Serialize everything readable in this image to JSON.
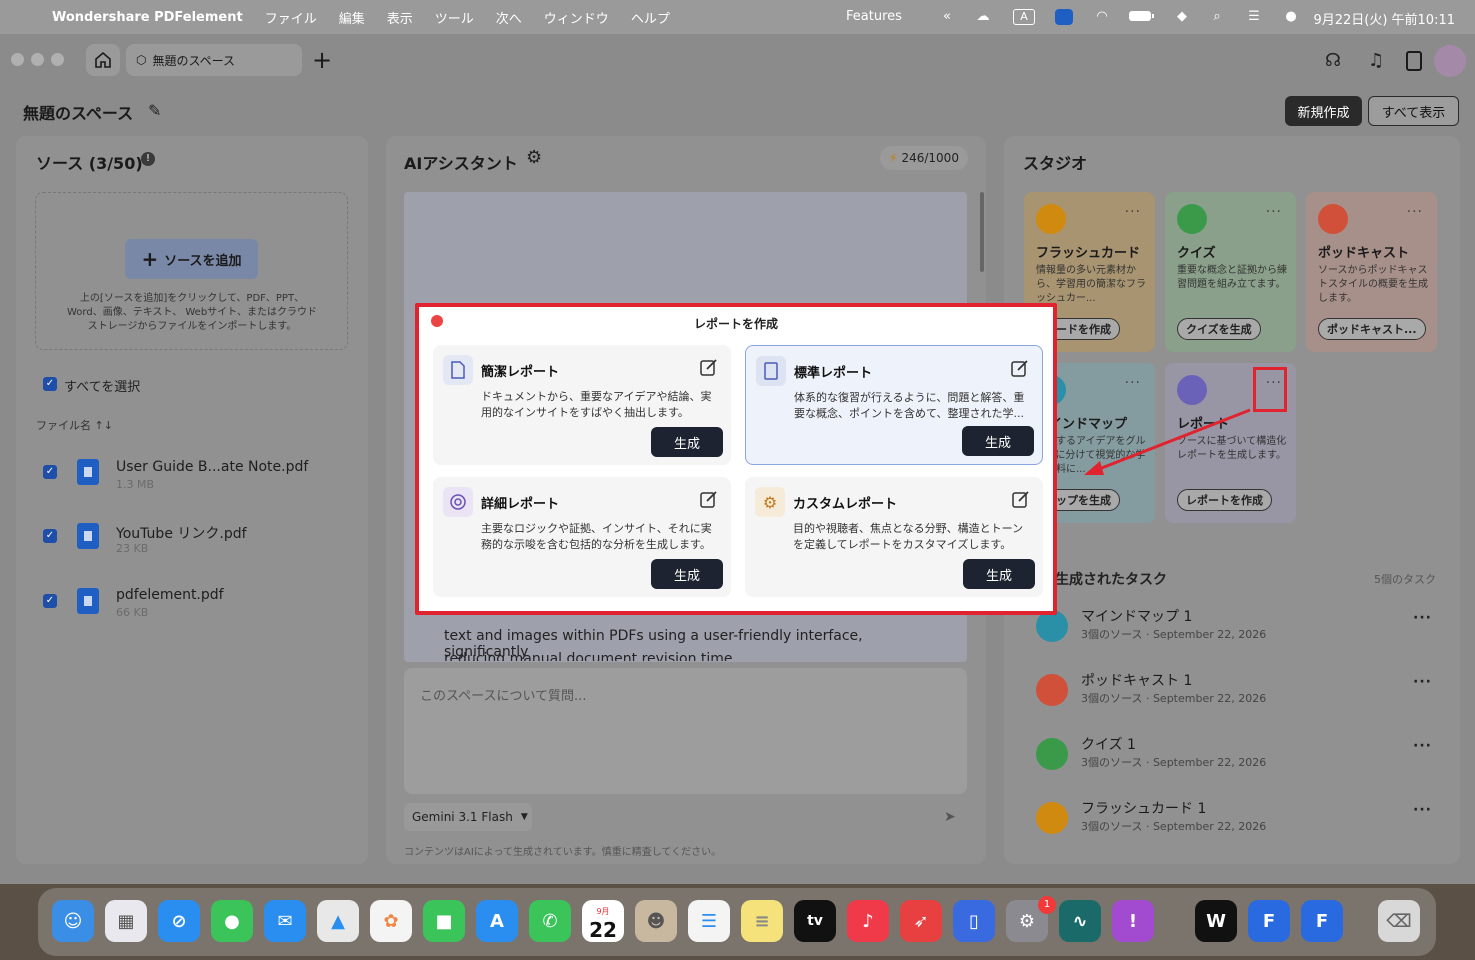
{
  "menubar": {
    "app_name": "Wondershare PDFelement",
    "items": [
      "ファイル",
      "編集",
      "表示",
      "ツール",
      "次へ",
      "ウィンドウ",
      "ヘルプ"
    ],
    "features": "Features",
    "clock": "9月22日(火) 午前10:11",
    "status_a": "A"
  },
  "titlebar": {
    "space_tab": "無題のスペース"
  },
  "header": {
    "title": "無題のスペース",
    "new_button": "新規作成",
    "show_all_button": "すべて表示"
  },
  "sources": {
    "title": "ソース (3/50)",
    "add_button": "ソースを追加",
    "help_text": "上の[ソースを追加]をクリックして、PDF、PPT、Word、画像、テキスト、 Webサイト、またはクラウドストレージからファイルをインポートします。",
    "select_all": "すべてを選択",
    "sort_label": "ファイル名 ↑↓",
    "files": [
      {
        "name": "User Guide B...ate Note.pdf",
        "size": "1.3 MB"
      },
      {
        "name": "YouTube リンク.pdf",
        "size": "23 KB"
      },
      {
        "name": "pdfelement.pdf",
        "size": "66 KB"
      }
    ]
  },
  "assistant": {
    "title": "AIアシスタント",
    "credits": "246/1000",
    "body_text": "text and images within PDFs using a user-friendly interface, significantly",
    "body_text_2": "reducing manual document revision time.",
    "input_placeholder": "このスペースについて質問...",
    "model": "Gemini 3.1 Flash",
    "disclaimer": "コンテンツはAIによって生成されています。慎重に精査してください。"
  },
  "studio": {
    "title": "スタジオ",
    "cards": [
      {
        "title": "フラッシュカード",
        "desc": "情報量の多い元素材から、学習用の簡潔なフラッシュカー...",
        "button": "カードを作成",
        "color": "#c8a060",
        "icon_color": "#d08a10"
      },
      {
        "title": "クイズ",
        "desc": "重要な概念と証拠から練習問題を組み立てます。",
        "button": "クイズを生成",
        "color": "#7fa27f",
        "icon_color": "#3a9a4a"
      },
      {
        "title": "ポッドキャスト",
        "desc": "ソースからポッドキャストスタイルの概要を生成します。",
        "button": "ポッドキャスト...",
        "color": "#b08a80",
        "icon_color": "#d0503a"
      },
      {
        "title": "マインドマップ",
        "desc": "関連するアイデアをグループに分けて視覚的な学習資料に...",
        "button": "マップを生成",
        "color": "#7e9fa5",
        "icon_color": "#2a90a8"
      },
      {
        "title": "レポート",
        "desc": "ソースに基づいて構造化レポートを生成します。",
        "button": "レポートを作成",
        "color": "#9a98a8",
        "icon_color": "#6a62b8"
      }
    ],
    "tasks_title": "生成されたタスク",
    "tasks_count": "5個のタスク",
    "tasks": [
      {
        "name": "マインドマップ 1",
        "meta": "3個のソース · September 22, 2026",
        "color": "#2a90a8"
      },
      {
        "name": "ポッドキャスト 1",
        "meta": "3個のソース · September 22, 2026",
        "color": "#d0503a"
      },
      {
        "name": "クイズ 1",
        "meta": "3個のソース · September 22, 2026",
        "color": "#3a9a4a"
      },
      {
        "name": "フラッシュカード 1",
        "meta": "3個のソース · September 22, 2026",
        "color": "#d08a10"
      }
    ]
  },
  "modal": {
    "title": "レポートを作成",
    "options": [
      {
        "title": "簡潔レポート",
        "desc": "ドキュメントから、重要なアイデアや結論、実用的なインサイトをすばやく抽出します。",
        "button": "生成"
      },
      {
        "title": "標準レポート",
        "desc": "体系的な復習が行えるように、問題と解答、重要な概念、ポイントを含めて、整理された学...",
        "button": "生成"
      },
      {
        "title": "詳細レポート",
        "desc": "主要なロジックや証拠、インサイト、それに実務的な示唆を含む包括的な分析を生成します。",
        "button": "生成"
      },
      {
        "title": "カスタムレポート",
        "desc": "目的や視聴者、焦点となる分野、構造とトーンを定義してレポートをカスタマイズします。",
        "button": "生成"
      }
    ]
  },
  "dock": {
    "calendar_day": "22",
    "calendar_month": "9月",
    "tv_label": "tv",
    "badge": "1"
  }
}
